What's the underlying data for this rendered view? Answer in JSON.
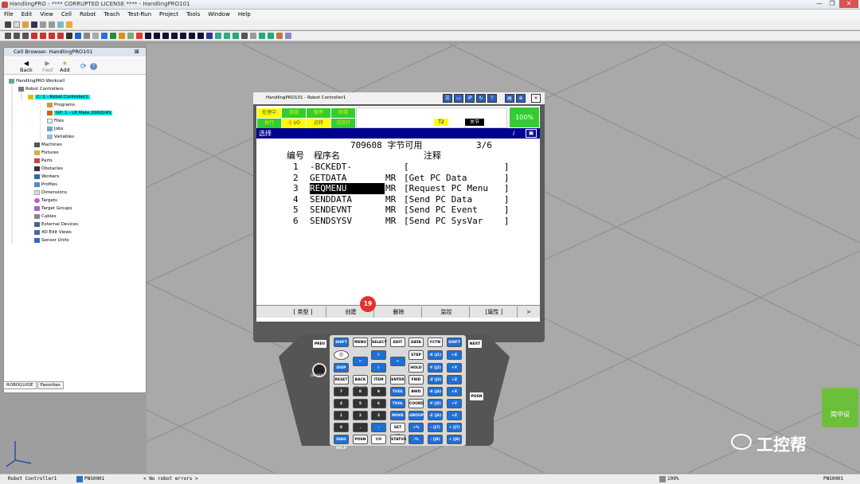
{
  "app": {
    "title": "HandlingPRO - **** CORRUPTED LICENSE **** - HandlingPRO101",
    "win_min": "—",
    "win_max": "❐",
    "win_close": "✕"
  },
  "menu": [
    "File",
    "Edit",
    "View",
    "Cell",
    "Robot",
    "Teach",
    "Test-Run",
    "Project",
    "Tools",
    "Window",
    "Help"
  ],
  "cell_browser": {
    "title": "Cell Browser- HandlingPRO101",
    "close": "⊠",
    "nav": {
      "back": "Back",
      "fwd": "Fwd",
      "add": "Add"
    },
    "tree": [
      {
        "label": "HandlingPRO Workcell",
        "level": 0,
        "hl": false
      },
      {
        "label": "Robot Controllers",
        "level": 1,
        "hl": false
      },
      {
        "label": "C: 1 - Robot Controller1",
        "level": 2,
        "hl": true
      },
      {
        "label": "Programs",
        "level": 3,
        "hl": false
      },
      {
        "label": "GP: 1 - LR Mate 200iD/4S",
        "level": 3,
        "hl": true
      },
      {
        "label": "Files",
        "level": 3,
        "hl": false
      },
      {
        "label": "Jobs",
        "level": 3,
        "hl": false
      },
      {
        "label": "Variables",
        "level": 3,
        "hl": false
      },
      {
        "label": "Machines",
        "level": 1,
        "hl": false
      },
      {
        "label": "Fixtures",
        "level": 1,
        "hl": false
      },
      {
        "label": "Parts",
        "level": 1,
        "hl": false
      },
      {
        "label": "Obstacles",
        "level": 1,
        "hl": false
      },
      {
        "label": "Workers",
        "level": 1,
        "hl": false
      },
      {
        "label": "Profiles",
        "level": 1,
        "hl": false
      },
      {
        "label": "Dimensions",
        "level": 1,
        "hl": false
      },
      {
        "label": "Targets",
        "level": 1,
        "hl": false
      },
      {
        "label": "Target Groups",
        "level": 1,
        "hl": false
      },
      {
        "label": "Cables",
        "level": 1,
        "hl": false
      },
      {
        "label": "External Devices",
        "level": 1,
        "hl": false
      },
      {
        "label": "4D Edit Views",
        "level": 1,
        "hl": false
      },
      {
        "label": "Sensor Units",
        "level": 1,
        "hl": false
      }
    ],
    "tabs": [
      "ROBOGUIDE",
      "Favorites"
    ]
  },
  "pendant": {
    "title": "HandlingPRO101 - Robot Controller1",
    "tb_icons": [
      "☰",
      "▭",
      "iP",
      "↻",
      "⊤",
      "▤",
      "⊕",
      "✕"
    ],
    "status": {
      "r1": [
        "处理中",
        "单段",
        "暂停",
        "异常"
      ],
      "r2": [
        "执行",
        "I/O",
        "运转",
        "试运行"
      ],
      "t2": "T2",
      "mode": "关节",
      "pct": "100%"
    },
    "selbar": "选择",
    "selbar_i": "i",
    "header": "709608 字节可用",
    "page": "3/6",
    "col_no": "编号",
    "col_name": "程序名",
    "col_comment": "注释",
    "programs": [
      {
        "no": "1",
        "name": "-BCKEDT-",
        "type": "",
        "comment": "[                  ]"
      },
      {
        "no": "2",
        "name": "GETDATA",
        "type": "MR",
        "comment": "[Get PC Data       ]"
      },
      {
        "no": "3",
        "name": "REQMENU",
        "type": "MR",
        "comment": "[Request PC Menu   ]"
      },
      {
        "no": "4",
        "name": "SENDDATA",
        "type": "MR",
        "comment": "[Send PC Data      ]"
      },
      {
        "no": "5",
        "name": "SENDEVNT",
        "type": "MR",
        "comment": "[Send PC Event     ]"
      },
      {
        "no": "6",
        "name": "SENDSYSV",
        "type": "MR",
        "comment": "[Send PC SysVar    ]"
      }
    ],
    "fkeys": [
      "[ 类型 ]",
      "创建",
      "删除",
      "监控",
      "[属性 ]",
      ">"
    ],
    "badge": "19",
    "keys": {
      "prev": "PREV",
      "shift": "SHIFT",
      "menu": "MENU",
      "select": "SELECT",
      "edit": "EDIT",
      "data": "DATA",
      "fctn": "FCTN",
      "next": "NEXT",
      "disp": "DISP",
      "step": "STEP",
      "hold": "HOLD",
      "fwd": "FWD",
      "bwd": "BWD",
      "reset": "RESET",
      "backspace": "BACK SPACE",
      "item": "ITEM",
      "enter": "ENTER",
      "tool1": "TOOL 1",
      "tool2": "TOOL 2",
      "move_menu": "MOVE MENU",
      "coord": "COORD",
      "group": "GROUP",
      "setup": "SET UP",
      "diag": "DIAG HELP",
      "posn": "POSN",
      "io": "I/O",
      "status": "STATUS",
      "posn_side": "POSN",
      "onoff": "ON OFF",
      "n7": "7",
      "n8": "8",
      "n9": "9",
      "n4": "4",
      "n5": "5",
      "n6": "6",
      "n1": "1",
      "n2": "2",
      "n3": "3",
      "n0": "0",
      "dot": ".",
      "minus": "-",
      "jx1": "-X (J1)",
      "jx2": "+X (J1)",
      "jy1": "-Y (J2)",
      "jy2": "+Y (J2)",
      "jz1": "-Z (J3)",
      "jz2": "+Z (J3)",
      "jx3": "-X (J4)",
      "jx4": "+X (J4)",
      "jy3": "-Y (J5)",
      "jy4": "+Y (J5)",
      "jz3": "-Z (J6)",
      "jz4": "+Z (J6)",
      "j71": "- (J7)",
      "j72": "+ (J7)",
      "j81": "- (J8)",
      "j82": "+ (J8)"
    }
  },
  "statusbar": {
    "controller": "Robot Controller1",
    "prg": "PNS0001",
    "errors": "< No robot errors >",
    "pct": "100%",
    "prg2": "PNS0001"
  },
  "watermark": "工控帮",
  "logo": "简中设"
}
